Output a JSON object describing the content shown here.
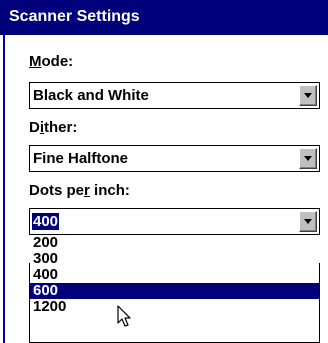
{
  "window": {
    "title": "Scanner Settings"
  },
  "mode": {
    "label_prefix": "",
    "label_underlined": "M",
    "label_rest": "ode:",
    "value": "Black and White"
  },
  "dither": {
    "label_prefix": "D",
    "label_underlined": "i",
    "label_rest": "ther:",
    "value": "Fine Halftone"
  },
  "dpi": {
    "label_prefix": "Dots pe",
    "label_underlined": "r",
    "label_rest": " inch:",
    "value": "400",
    "options": [
      "200",
      "300",
      "400",
      "600",
      "1200"
    ],
    "highlighted_option": "600"
  },
  "colors": {
    "titlebar": "#00007b",
    "highlight": "#00007b",
    "button_face": "#c0c0c0"
  },
  "icons": {
    "dropdown": "chevron-down-icon",
    "cursor": "mouse-pointer-icon"
  }
}
